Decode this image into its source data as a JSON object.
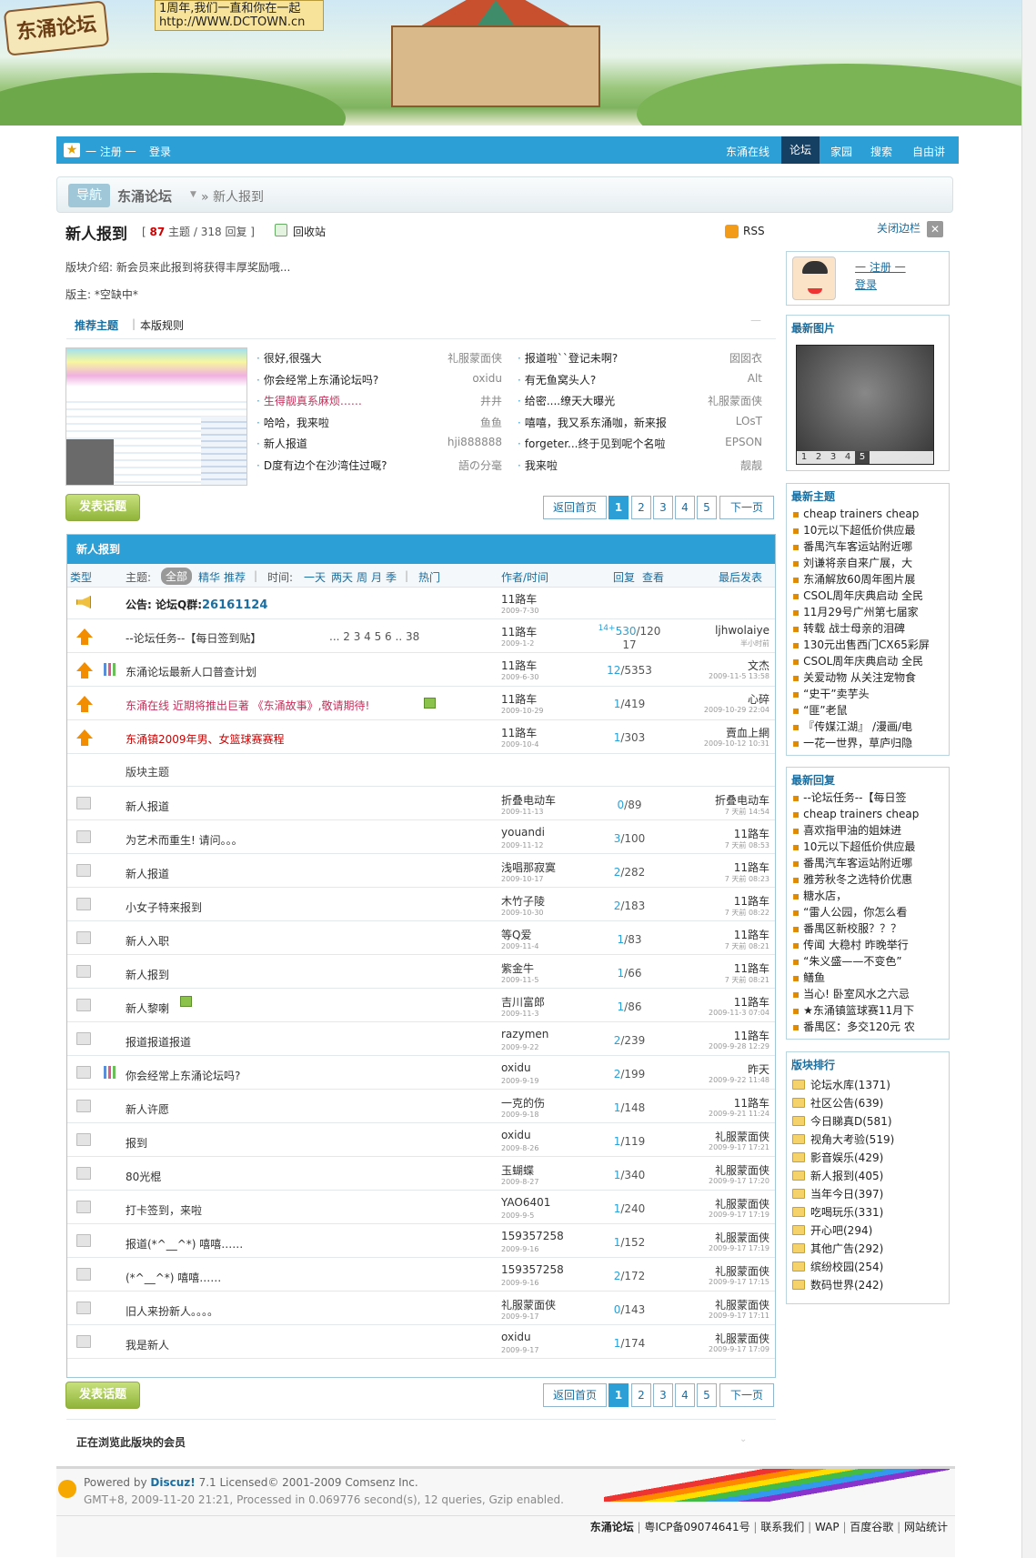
{
  "banner": {
    "logo": "东涌论坛",
    "slogan_line1": "1周年,我们一直和你在一起",
    "slogan_line2": "http://WWW.DCTOWN.cn"
  },
  "topnav": {
    "register": "一 注册 一",
    "login": "登录",
    "links": [
      "东涌在线",
      "论坛",
      "家园",
      "搜索",
      "自由讲"
    ],
    "active": "论坛"
  },
  "breadcrumb": {
    "nav": "导航",
    "forum": "东涌论坛",
    "current": "» 新人报到"
  },
  "forum": {
    "name": "新人报到",
    "topics": "87",
    "topics_label": "主题",
    "replies": "318",
    "replies_label": "回复",
    "recycle": "回收站",
    "rss": "RSS",
    "intro": "版块介绍: 新会员来此报到将获得丰厚奖励哦...",
    "moderator": "版主: *空缺中*",
    "close_sidebar": "关闭边栏"
  },
  "tabs": {
    "recommend": "推荐主题",
    "rules": "本版规则"
  },
  "recommend": {
    "left": [
      [
        "很好,很强大",
        "礼服蒙面侠"
      ],
      [
        "你会经常上东涌论坛吗?",
        "oxidu"
      ],
      [
        "生得靓真系麻烦……",
        "井井"
      ],
      [
        "哈哈，我来啦",
        "鱼鱼"
      ],
      [
        "新人报道",
        "hji888888"
      ],
      [
        "D度有边个在沙湾住过嘅?",
        "語の分毫"
      ]
    ],
    "right": [
      [
        "报道啦``登记未啊?",
        "囡囡衣"
      ],
      [
        "有无鱼窝头人?",
        "Alt"
      ],
      [
        "给密....缭天大曝光",
        "礼服蒙面侠"
      ],
      [
        "嘻嘻，我又系东涌咖，新来报",
        "LOsT"
      ],
      [
        "forgeter...终于见到呢个名啦",
        "EPSON"
      ],
      [
        "我来啦",
        "靓靓"
      ]
    ]
  },
  "actions": {
    "post": "发表话题",
    "back": "返回首页",
    "pages": [
      "1",
      "2",
      "3",
      "4",
      "5"
    ],
    "next": "下一页"
  },
  "table": {
    "title": "新人报到",
    "header": {
      "type": "类型",
      "subject": "主题:",
      "all": "全部",
      "digest": "精华",
      "recommend": "推荐",
      "time": "时间:",
      "time_opts": [
        "一天",
        "两天",
        "周",
        "月",
        "季"
      ],
      "hot": "热门",
      "author": "作者/时间",
      "replies": "回复",
      "views": "查看",
      "last": "最后发表"
    },
    "announce": {
      "label": "公告:",
      "text": "论坛Q群:",
      "qq": "26161124",
      "author": "11路车",
      "date": "2009-7-30"
    },
    "sticky": [
      {
        "subject": "--论坛任务--【每日签到贴】",
        "pages": "... 2 3 4 5 6 .. 38",
        "author": "11路车",
        "date": "2009-1-2",
        "top": "14+",
        "replies": "530",
        "views": "120",
        "views2": "17",
        "last": "ljhwolaiye",
        "lastdate": "半小时前",
        "icon": "arrow",
        "color": "dark"
      },
      {
        "subject": "东涌论坛最新人口普查计划",
        "author": "11路车",
        "date": "2009-6-30",
        "replies": "12",
        "views": "5353",
        "last": "文杰",
        "lastdate": "2009-11-5 13:58",
        "icon": "arrow-chart",
        "color": "dark"
      },
      {
        "subject": "东涌在线 近期将推出巨著 《东涌故事》,敬请期待!",
        "author": "11路车",
        "date": "2009-10-29",
        "replies": "1",
        "views": "419",
        "last": "心碎",
        "lastdate": "2009-10-29 22:04",
        "icon": "arrow",
        "color": "pink",
        "attach": true
      },
      {
        "subject": "东涌镇2009年男、女篮球赛赛程",
        "author": "11路车",
        "date": "2009-10-4",
        "replies": "1",
        "views": "303",
        "last": "賣血上網",
        "lastdate": "2009-10-12 10:31",
        "icon": "arrow",
        "color": "red"
      }
    ],
    "section_label": "版块主题",
    "threads": [
      {
        "subject": "新人报道",
        "author": "折叠电动车",
        "date": "2009-11-13",
        "replies": "0",
        "views": "89",
        "last": "折叠电动车",
        "lastdate": "7 天前 14:54"
      },
      {
        "subject": "为艺术而重生! 请问。。。",
        "author": "youandi",
        "date": "2009-11-12",
        "replies": "3",
        "views": "100",
        "last": "11路车",
        "lastdate": "7 天前 08:53"
      },
      {
        "subject": "新人报道",
        "author": "浅唱那寂寞",
        "date": "2009-10-17",
        "replies": "2",
        "views": "282",
        "last": "11路车",
        "lastdate": "7 天前 08:23"
      },
      {
        "subject": "小女子特来报到",
        "author": "木竹子陵",
        "date": "2009-10-30",
        "replies": "2",
        "views": "183",
        "last": "11路车",
        "lastdate": "7 天前 08:22"
      },
      {
        "subject": "新人入职",
        "author": "等Q爱",
        "date": "2009-11-4",
        "replies": "1",
        "views": "83",
        "last": "11路车",
        "lastdate": "7 天前 08:21"
      },
      {
        "subject": "新人报到",
        "author": "紫金牛",
        "date": "2009-11-5",
        "replies": "1",
        "views": "66",
        "last": "11路车",
        "lastdate": "7 天前 08:21"
      },
      {
        "subject": "新人黎喇",
        "author": "吉川富郎",
        "date": "2009-11-3",
        "replies": "1",
        "views": "86",
        "last": "11路车",
        "lastdate": "2009-11-3 07:04",
        "attach": true
      },
      {
        "subject": "报道报道报道",
        "author": "razymen",
        "date": "2009-9-22",
        "replies": "2",
        "views": "239",
        "last": "11路车",
        "lastdate": "2009-9-28 12:29"
      },
      {
        "subject": "你会经常上东涌论坛吗?",
        "author": "oxidu",
        "date": "2009-9-19",
        "replies": "2",
        "views": "199",
        "last": "昨天",
        "lastdate": "2009-9-22 11:48",
        "chart": true
      },
      {
        "subject": "新人许愿",
        "author": "一克的伤",
        "date": "2009-9-18",
        "replies": "1",
        "views": "148",
        "last": "11路车",
        "lastdate": "2009-9-21 11:24"
      },
      {
        "subject": "报到",
        "author": "oxidu",
        "date": "2009-8-26",
        "replies": "1",
        "views": "119",
        "last": "礼服蒙面侠",
        "lastdate": "2009-9-17 17:21"
      },
      {
        "subject": "80光棍",
        "author": "玉蝴蝶",
        "date": "2009-8-27",
        "replies": "1",
        "views": "340",
        "last": "礼服蒙面侠",
        "lastdate": "2009-9-17 17:20"
      },
      {
        "subject": "打卡签到，来啦",
        "author": "YAO6401",
        "date": "2009-9-5",
        "replies": "1",
        "views": "240",
        "last": "礼服蒙面侠",
        "lastdate": "2009-9-17 17:19"
      },
      {
        "subject": "报道(*^__^*) 嘻嘻……",
        "author": "159357258",
        "date": "2009-9-16",
        "replies": "1",
        "views": "152",
        "last": "礼服蒙面侠",
        "lastdate": "2009-9-17 17:19"
      },
      {
        "subject": "(*^__^*) 嘻嘻……",
        "author": "159357258",
        "date": "2009-9-16",
        "replies": "2",
        "views": "172",
        "last": "礼服蒙面侠",
        "lastdate": "2009-9-17 17:15"
      },
      {
        "subject": "旧人来扮新人。。。。",
        "author": "礼服蒙面侠",
        "date": "2009-9-17",
        "replies": "0",
        "views": "143",
        "last": "礼服蒙面侠",
        "lastdate": "2009-9-17 17:11"
      },
      {
        "subject": "我是新人",
        "author": "oxidu",
        "date": "2009-9-17",
        "replies": "1",
        "views": "174",
        "last": "礼服蒙面侠",
        "lastdate": "2009-9-17 17:09"
      }
    ]
  },
  "online": "正在浏览此版块的会员",
  "sidebar": {
    "register": "一 注册 一",
    "login": "登录",
    "latest_images": "最新图片",
    "image_pages": [
      "1",
      "2",
      "3",
      "4",
      "5"
    ],
    "latest_topics": "最新主题",
    "topics": [
      "cheap trainers cheap",
      "10元以下超低价供应最",
      "番禺汽车客运站附近哪",
      "刘谦将亲自来广展，大",
      "东涌解放60周年图片展",
      "CSOL周年庆典启动 全民",
      "11月29号广州第七届家",
      "转载 战士母亲的泪碑",
      "130元出售西门CX65彩屏",
      "CSOL周年庆典启动 全民",
      "关爱动物 从关注宠物食",
      "“史干”卖芋头",
      "“匪”老鼠",
      "『传媒江湖』 /漫画/电",
      "一花一世界，草庐归隐"
    ],
    "latest_replies": "最新回复",
    "replies": [
      "--论坛任务--【每日签",
      "cheap trainers cheap",
      "喜欢指甲油的姐妹进",
      "10元以下超低价供应最",
      "番禺汽车客运站附近哪",
      "雅芳秋冬之选特价优惠",
      "糖水店，",
      "“雷人公园，你怎么看",
      "番禺区新校服？？？",
      "传闻 大稳村 昨晚举行",
      "“朱义盛——不变色”",
      "鳝鱼",
      "当心! 卧室风水之六忌",
      "★东涌镇篮球赛11月下",
      "番禺区：多交120元 农"
    ],
    "ranking": "版块排行",
    "forums": [
      "论坛水库(1371)",
      "社区公告(639)",
      "今日睇真D(581)",
      "视角大考验(519)",
      "影音娱乐(429)",
      "新人报到(405)",
      "当年今日(397)",
      "吃喝玩乐(331)",
      "开心吧(294)",
      "其他广告(292)",
      "缤纷校园(254)",
      "数码世界(242)"
    ]
  },
  "footer": {
    "powered": "Powered by",
    "brand": "Discuz!",
    "version": "7.1 Licensed© 2001-2009 Comsenz Inc.",
    "stats": "GMT+8, 2009-11-20 21:21, Processed in 0.069776 second(s), 12 queries, Gzip enabled.",
    "links": [
      "东涌论坛",
      "粤ICP备09074641号",
      "联系我们",
      "WAP",
      "百度谷歌",
      "网站统计"
    ]
  },
  "colors": {
    "accent": "#2c9fd6",
    "nav_active": "#153f63",
    "orange": "#f28c00"
  }
}
